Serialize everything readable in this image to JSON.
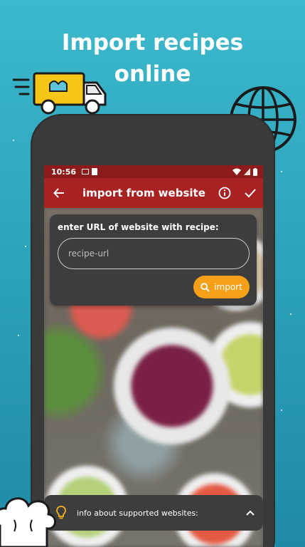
{
  "headline": {
    "line1": "Import recipes",
    "line2": "online"
  },
  "status_bar": {
    "time": "10:56"
  },
  "app_bar": {
    "title": "import from website",
    "back_icon": "arrow-left-icon",
    "info_icon": "info-icon",
    "confirm_icon": "check-icon"
  },
  "import_card": {
    "label": "enter URL of website with recipe:",
    "url_placeholder": "recipe-url",
    "url_value": "",
    "import_button_label": "import",
    "import_icon": "search-icon"
  },
  "bottom_panel": {
    "text": "info about supported websites:",
    "bulb_icon": "lightbulb-icon",
    "expand_icon": "chevron-up-icon"
  },
  "colors": {
    "background": "#2a9fb8",
    "status_bar": "#8e1b1b",
    "app_bar": "#a92222",
    "card": "#3d3d3d",
    "accent": "#f6a01a"
  }
}
